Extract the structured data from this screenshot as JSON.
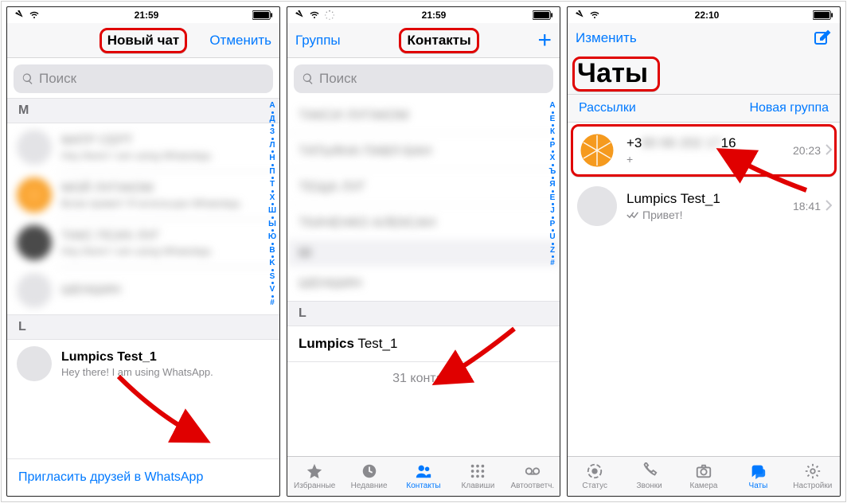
{
  "accent": "#0079ff",
  "highlight": "#e00000",
  "screen1": {
    "time": "21:59",
    "title": "Новый чат",
    "cancel": "Отменить",
    "search_placeholder": "Поиск",
    "sections": {
      "M": [
        {
          "name": "МАТР СЕРТ",
          "sub": "Hey there! I am using WhatsApp."
        },
        {
          "name": "МОЙ ЛУГАКОМ",
          "sub": "Всем привет! Я использую WhatsApp."
        },
        {
          "name": "ТАКС ПСИХ ЛУГ",
          "sub": "Hey there! I am using WhatsApp."
        },
        {
          "name": "ШЕНШИН",
          "sub": ""
        }
      ],
      "L": [
        {
          "name": "Lumpics Test_1",
          "sub": "Hey there! I am using WhatsApp."
        }
      ]
    },
    "index": [
      "А",
      "•",
      "Д",
      "•",
      "З",
      "•",
      "Л",
      "•",
      "Н",
      "•",
      "П",
      "•",
      "Т",
      "•",
      "Х",
      "•",
      "Ш",
      "•",
      "Ы",
      "•",
      "Ю",
      "•",
      "B",
      "•",
      "K",
      "•",
      "S",
      "•",
      "V",
      "•",
      "#"
    ],
    "invite": "Пригласить друзей в WhatsApp"
  },
  "screen2": {
    "time": "21:59",
    "left": "Группы",
    "title": "Контакты",
    "search_placeholder": "Поиск",
    "blurred": [
      "ТАКСИ ЛУГАКОМ",
      "ТАТЬЯНА ПАВЛ-БАН",
      "ТЕЩА ЛУГ",
      "ТКАЧЕНКО АЛЕКСАН",
      "Ш",
      "ШЕНШИН"
    ],
    "section_L_label": "L",
    "section_L_name_bold": "Lumpics",
    "section_L_name_rest": " Test_1",
    "count": "31 контакт",
    "index": [
      "А",
      "•",
      "Е",
      "•",
      "К",
      "•",
      "Р",
      "•",
      "Х",
      "•",
      "Ъ",
      "•",
      "Я",
      "•",
      "E",
      "•",
      "J",
      "•",
      "P",
      "•",
      "U",
      "•",
      "Z",
      "•",
      "#"
    ],
    "tabs": {
      "fav": "Избранные",
      "recent": "Недавние",
      "contacts": "Контакты",
      "keypad": "Клавиши",
      "voicemail": "Автоответч."
    }
  },
  "screen3": {
    "time": "22:10",
    "edit": "Изменить",
    "title": "Чаты",
    "broadcasts": "Рассылки",
    "newgroup": "Новая группа",
    "chats": [
      {
        "title_prefix": "+3",
        "title_blur": "80 66 202 17",
        "title_suffix": "16",
        "sub": "+",
        "time": "20:23"
      },
      {
        "title": "Lumpics Test_1",
        "sub": "Привет!",
        "time": "18:41"
      }
    ],
    "tabs": {
      "status": "Статус",
      "calls": "Звонки",
      "camera": "Камера",
      "chats": "Чаты",
      "settings": "Настройки"
    }
  }
}
